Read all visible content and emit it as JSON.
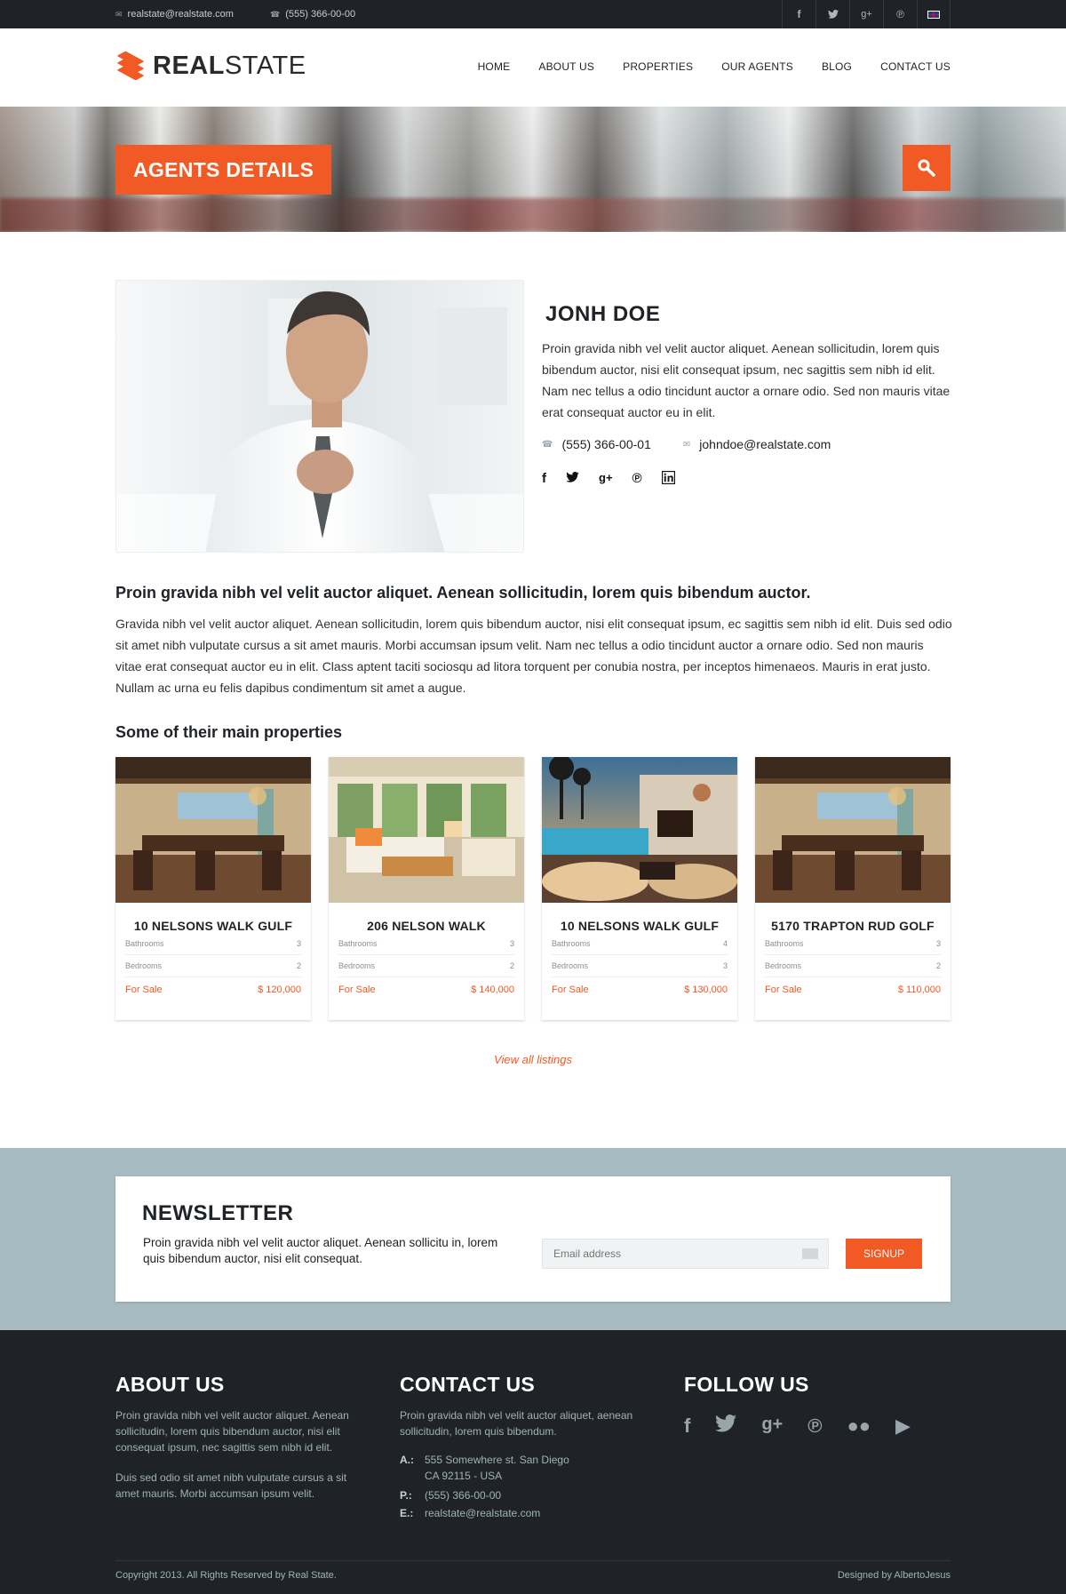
{
  "topbar": {
    "email": "realstate@realstate.com",
    "phone": "(555) 366-00-00",
    "social": [
      "f",
      "t",
      "g+",
      "p"
    ]
  },
  "header": {
    "logo_bold": "REAL",
    "logo_light": "STATE",
    "nav": [
      "HOME",
      "ABOUT US",
      "PROPERTIES",
      "OUR AGENTS",
      "BLOG",
      "CONTACT US"
    ]
  },
  "banner": {
    "title": "AGENTS DETAILS"
  },
  "agent": {
    "name": "JONH DOE",
    "bio_1": "Proin gravida nibh vel velit auctor aliquet. Aenean sollicitudin, lorem quis bibendum auctor, nisi elit consequat ipsum, nec sagittis sem nibh id elit.",
    "bio_2": "Nam nec tellus a odio tincidunt auctor a ornare odio. Sed non  mauris vitae erat consequat auctor eu in elit.",
    "phone": "(555) 366-00-01",
    "email": "johndoe@realstate.com"
  },
  "lead": {
    "heading": "Proin gravida nibh vel velit auctor aliquet. Aenean sollicitudin, lorem quis bibendum auctor.",
    "text": "Gravida nibh vel velit auctor aliquet. Aenean sollicitudin, lorem quis bibendum auctor, nisi elit consequat ipsum, ec sagittis sem nibh id elit. Duis sed odio sit amet nibh vulputate cursus a sit amet mauris. Morbi accumsan ipsum velit. Nam nec tellus a odio tincidunt auctor a ornare odio. Sed non  mauris vitae erat consequat auctor eu in elit. Class aptent taciti sociosqu ad litora torquent per conubia nostra, per inceptos himenaeos. Mauris in erat justo. Nullam ac urna eu felis dapibus condimentum sit amet a augue."
  },
  "properties": {
    "heading": "Some of their main properties",
    "bath_label": "Bathrooms",
    "bed_label": "Bedrooms",
    "items": [
      {
        "title": "10 NELSONS WALK GULF",
        "bathrooms": "3",
        "bedrooms": "2",
        "status": "For Sale",
        "price": "$ 120,000"
      },
      {
        "title": "206 NELSON WALK",
        "bathrooms": "3",
        "bedrooms": "2",
        "status": "For Sale",
        "price": "$ 140,000"
      },
      {
        "title": "10 NELSONS WALK GULF",
        "bathrooms": "4",
        "bedrooms": "3",
        "status": "For Sale",
        "price": "$ 130,000"
      },
      {
        "title": "5170 TRAPTON RUD GOLF",
        "bathrooms": "3",
        "bedrooms": "2",
        "status": "For Sale",
        "price": "$ 110,000"
      }
    ],
    "view_all": "View all listings"
  },
  "newsletter": {
    "title": "NEWSLETTER",
    "text": "Proin gravida nibh vel velit auctor aliquet. Aenean sollicitu in, lorem quis bibendum auctor, nisi elit consequat.",
    "placeholder": "Email address",
    "button": "SIGNUP"
  },
  "footer": {
    "about_title": "ABOUT US",
    "about_p1": "Proin gravida nibh vel velit auctor aliquet. Aenean sollicitudin, lorem quis bibendum auctor, nisi elit consequat ipsum, nec sagittis sem nibh id elit.",
    "about_p2": "Duis sed odio sit amet nibh vulputate cursus a sit amet mauris. Morbi accumsan ipsum velit.",
    "contact_title": "CONTACT US",
    "contact_p": "Proin gravida nibh vel velit auctor aliquet, aenean sollicitudin, lorem quis bibendum.",
    "address_key": "A.:",
    "address_1": "555 Somewhere st. San Diego",
    "address_2": "CA 92115 - USA",
    "phone_key": "P.:",
    "phone": "(555) 366-00-00",
    "email_key": "E.:",
    "email": "realstate@realstate.com",
    "follow_title": "FOLLOW US",
    "copyright": "Copyright 2013. All Rights Reserved by Real State.",
    "credit": "Designed by AlbertoJesus"
  },
  "colors": {
    "accent": "#f15a24",
    "dark": "#1f2327",
    "newsletter_band": "#a7bcc1"
  }
}
